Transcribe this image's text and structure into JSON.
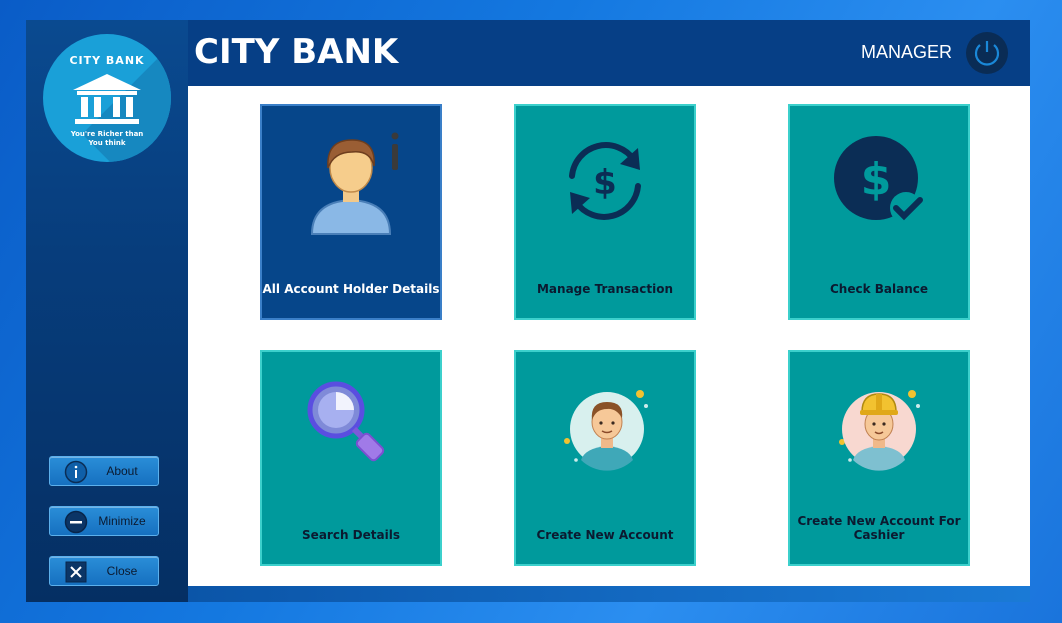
{
  "logo": {
    "brand": "CITY BANK",
    "tagline_line1": "You're Richer than",
    "tagline_line2": "You think"
  },
  "header": {
    "title": "CITY BANK",
    "role": "MANAGER"
  },
  "sidebar": {
    "about_label": "About",
    "minimize_label": "Minimize",
    "close_label": "Close"
  },
  "tiles": [
    {
      "label": "All Account Holder Details",
      "icon": "user-info-icon",
      "active": true
    },
    {
      "label": "Manage Transaction",
      "icon": "dollar-exchange-icon",
      "active": false
    },
    {
      "label": "Check Balance",
      "icon": "dollar-check-icon",
      "active": false
    },
    {
      "label": "Search Details",
      "icon": "magnifier-icon",
      "active": false
    },
    {
      "label": "Create New Account",
      "icon": "man-avatar-icon",
      "active": false
    },
    {
      "label": "Create New Account For Cashier",
      "icon": "worker-avatar-icon",
      "active": false
    }
  ],
  "colors": {
    "tile_teal": "#009a9c",
    "tile_active": "#06468a",
    "header_blue": "#063f86"
  }
}
